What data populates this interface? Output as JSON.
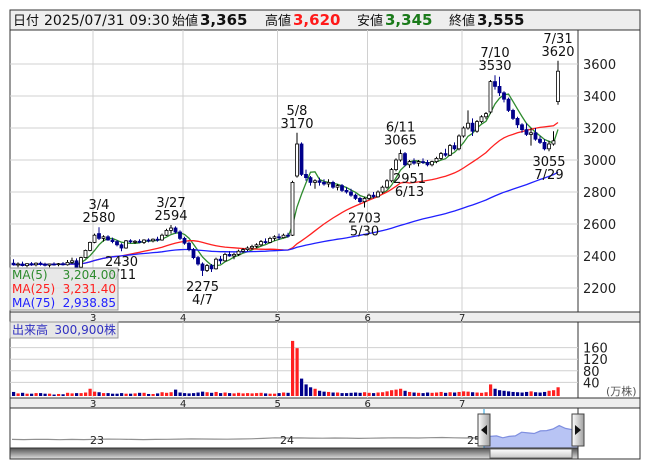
{
  "header": {
    "date_label": "日付",
    "datetime": "2025/07/31 09:30",
    "open_label": "始値",
    "open": "3,365",
    "high_label": "高値",
    "high": "3,620",
    "low_label": "安値",
    "low": "3,345",
    "close_label": "終値",
    "close": "3,555"
  },
  "legend": {
    "ma5_label": "MA(5)",
    "ma5_value": "3,204.00",
    "ma25_label": "MA(25)",
    "ma25_value": "3,231.40",
    "ma75_label": "MA(75)",
    "ma75_value": "2,938.85"
  },
  "volume_header": {
    "label": "出来高",
    "value": "300,900株"
  },
  "volume_unit": "(万株)",
  "colors": {
    "up_fill": "#ffffff",
    "down": "#00008b",
    "vol_up": "#ff2020",
    "vol_down": "#00008b",
    "vol_flat": "#808080",
    "ma5": "#2e8b2e",
    "ma25": "#ff2020",
    "ma75": "#2020ff",
    "nav_fill": "#b8c4f4",
    "nav_line": "#7f8fe0"
  },
  "chart_data": {
    "type": "candlestick",
    "ylim": [
      2150,
      3750
    ],
    "yticks": [
      2200,
      2400,
      2600,
      2800,
      3000,
      3200,
      3400,
      3600
    ],
    "volume_ticks": [
      40,
      80,
      120,
      160
    ],
    "volume_unit": "万株",
    "month_labels": [
      {
        "label": "3",
        "date": "3/3"
      },
      {
        "label": "4",
        "date": "4/1"
      },
      {
        "label": "5",
        "date": "5/1"
      },
      {
        "label": "6",
        "date": "6/2"
      },
      {
        "label": "7",
        "date": "7/1"
      }
    ],
    "ma_periods": [
      5,
      25,
      75
    ],
    "candles": [
      [
        "2/3",
        2355,
        2380,
        2340,
        2345,
        14
      ],
      [
        "2/4",
        2345,
        2360,
        2330,
        2350,
        9
      ],
      [
        "2/5",
        2350,
        2365,
        2335,
        2340,
        11
      ],
      [
        "2/6",
        2340,
        2355,
        2330,
        2352,
        8
      ],
      [
        "2/7",
        2352,
        2362,
        2338,
        2345,
        8
      ],
      [
        "2/10",
        2345,
        2360,
        2335,
        2355,
        10
      ],
      [
        "2/12",
        2355,
        2365,
        2340,
        2348,
        10
      ],
      [
        "2/13",
        2348,
        2358,
        2335,
        2342,
        8
      ],
      [
        "2/14",
        2342,
        2352,
        2330,
        2350,
        8
      ],
      [
        "2/17",
        2350,
        2360,
        2340,
        2346,
        5
      ],
      [
        "2/18",
        2346,
        2356,
        2336,
        2352,
        7
      ],
      [
        "2/19",
        2352,
        2362,
        2340,
        2345,
        6
      ],
      [
        "2/20",
        2345,
        2375,
        2340,
        2360,
        11
      ],
      [
        "2/21",
        2360,
        2390,
        2350,
        2370,
        9
      ],
      [
        "2/25",
        2370,
        2385,
        2320,
        2330,
        10
      ],
      [
        "2/26",
        2330,
        2395,
        2325,
        2390,
        10
      ],
      [
        "2/27",
        2390,
        2440,
        2385,
        2435,
        12
      ],
      [
        "2/28",
        2435,
        2490,
        2430,
        2485,
        25
      ],
      [
        "3/3",
        2485,
        2540,
        2480,
        2530,
        15
      ],
      [
        "3/4",
        2540,
        2580,
        2500,
        2510,
        13
      ],
      [
        "3/5",
        2510,
        2530,
        2490,
        2520,
        10
      ],
      [
        "3/6",
        2520,
        2530,
        2495,
        2500,
        10
      ],
      [
        "3/7",
        2500,
        2515,
        2480,
        2490,
        8
      ],
      [
        "3/10",
        2490,
        2500,
        2460,
        2470,
        8
      ],
      [
        "3/11",
        2470,
        2480,
        2430,
        2450,
        10
      ],
      [
        "3/12",
        2450,
        2500,
        2445,
        2495,
        8
      ],
      [
        "3/13",
        2495,
        2505,
        2480,
        2490,
        8
      ],
      [
        "3/14",
        2490,
        2500,
        2475,
        2492,
        9
      ],
      [
        "3/17",
        2492,
        2505,
        2480,
        2485,
        11
      ],
      [
        "3/18",
        2485,
        2505,
        2475,
        2500,
        11
      ],
      [
        "3/19",
        2500,
        2510,
        2485,
        2495,
        7
      ],
      [
        "3/21",
        2495,
        2510,
        2485,
        2505,
        7
      ],
      [
        "3/24",
        2505,
        2520,
        2490,
        2500,
        9
      ],
      [
        "3/25",
        2500,
        2540,
        2495,
        2530,
        13
      ],
      [
        "3/26",
        2530,
        2570,
        2525,
        2560,
        11
      ],
      [
        "3/27",
        2560,
        2594,
        2540,
        2575,
        13
      ],
      [
        "3/28",
        2575,
        2585,
        2540,
        2550,
        22
      ],
      [
        "3/31",
        2550,
        2560,
        2500,
        2510,
        12
      ],
      [
        "4/1",
        2510,
        2520,
        2470,
        2480,
        10
      ],
      [
        "4/2",
        2480,
        2490,
        2430,
        2440,
        9
      ],
      [
        "4/3",
        2440,
        2450,
        2380,
        2390,
        10
      ],
      [
        "4/4",
        2390,
        2400,
        2340,
        2350,
        12
      ],
      [
        "4/7",
        2350,
        2360,
        2275,
        2310,
        15
      ],
      [
        "4/8",
        2310,
        2350,
        2300,
        2340,
        13
      ],
      [
        "4/9",
        2340,
        2350,
        2300,
        2320,
        11
      ],
      [
        "4/10",
        2320,
        2390,
        2315,
        2380,
        14
      ],
      [
        "4/11",
        2380,
        2400,
        2350,
        2370,
        10
      ],
      [
        "4/14",
        2370,
        2420,
        2365,
        2410,
        12
      ],
      [
        "4/15",
        2410,
        2430,
        2395,
        2400,
        10
      ],
      [
        "4/16",
        2400,
        2420,
        2380,
        2410,
        9
      ],
      [
        "4/17",
        2410,
        2440,
        2400,
        2430,
        11
      ],
      [
        "4/18",
        2430,
        2450,
        2420,
        2440,
        9
      ],
      [
        "4/21",
        2440,
        2460,
        2430,
        2450,
        10
      ],
      [
        "4/22",
        2450,
        2470,
        2440,
        2460,
        9
      ],
      [
        "4/23",
        2460,
        2480,
        2450,
        2470,
        10
      ],
      [
        "4/24",
        2470,
        2500,
        2460,
        2490,
        11
      ],
      [
        "4/25",
        2490,
        2510,
        2475,
        2485,
        9
      ],
      [
        "4/28",
        2485,
        2520,
        2480,
        2510,
        8
      ],
      [
        "4/30",
        2510,
        2530,
        2495,
        2520,
        8
      ],
      [
        "5/1",
        2520,
        2540,
        2500,
        2515,
        10
      ],
      [
        "5/2",
        2515,
        2540,
        2510,
        2530,
        12
      ],
      [
        "5/7",
        2530,
        2545,
        2515,
        2525,
        11
      ],
      [
        "5/8",
        2530,
        2870,
        2525,
        2860,
        190
      ],
      [
        "5/9",
        2900,
        3170,
        2890,
        3100,
        165
      ],
      [
        "5/12",
        3100,
        3110,
        2900,
        2910,
        60
      ],
      [
        "5/13",
        2910,
        2940,
        2870,
        2890,
        40
      ],
      [
        "5/14",
        2890,
        2900,
        2840,
        2860,
        30
      ],
      [
        "5/15",
        2860,
        2880,
        2820,
        2870,
        25
      ],
      [
        "5/16",
        2870,
        2890,
        2840,
        2860,
        18
      ],
      [
        "5/19",
        2860,
        2880,
        2840,
        2850,
        15
      ],
      [
        "5/20",
        2850,
        2880,
        2830,
        2860,
        14
      ],
      [
        "5/21",
        2860,
        2870,
        2820,
        2830,
        12
      ],
      [
        "5/22",
        2830,
        2850,
        2810,
        2840,
        12
      ],
      [
        "5/23",
        2840,
        2850,
        2800,
        2810,
        10
      ],
      [
        "5/26",
        2810,
        2830,
        2790,
        2800,
        10
      ],
      [
        "5/27",
        2800,
        2820,
        2770,
        2780,
        11
      ],
      [
        "5/28",
        2780,
        2790,
        2750,
        2760,
        12
      ],
      [
        "5/29",
        2760,
        2770,
        2730,
        2740,
        11
      ],
      [
        "5/30",
        2740,
        2770,
        2703,
        2760,
        13
      ],
      [
        "6/2",
        2760,
        2790,
        2750,
        2780,
        11
      ],
      [
        "6/3",
        2780,
        2800,
        2760,
        2770,
        10
      ],
      [
        "6/4",
        2770,
        2810,
        2765,
        2800,
        12
      ],
      [
        "6/5",
        2800,
        2840,
        2790,
        2830,
        13
      ],
      [
        "6/6",
        2830,
        2880,
        2820,
        2870,
        16
      ],
      [
        "6/9",
        2870,
        2950,
        2860,
        2940,
        20
      ],
      [
        "6/10",
        2940,
        3010,
        2930,
        3000,
        22
      ],
      [
        "6/11",
        3000,
        3065,
        2990,
        3040,
        25
      ],
      [
        "6/12",
        3040,
        3050,
        2960,
        2970,
        18
      ],
      [
        "6/13",
        2970,
        3000,
        2951,
        2990,
        14
      ],
      [
        "6/16",
        2990,
        3010,
        2970,
        2980,
        12
      ],
      [
        "6/17",
        2980,
        3000,
        2960,
        2990,
        11
      ],
      [
        "6/18",
        2990,
        3010,
        2975,
        2985,
        10
      ],
      [
        "6/19",
        2985,
        3000,
        2960,
        2970,
        12
      ],
      [
        "6/20",
        2970,
        2995,
        2960,
        2990,
        11
      ],
      [
        "6/23",
        2990,
        3020,
        2980,
        3010,
        12
      ],
      [
        "6/24",
        3010,
        3050,
        3000,
        3040,
        14
      ],
      [
        "6/25",
        3040,
        3070,
        3020,
        3030,
        11
      ],
      [
        "6/26",
        3030,
        3100,
        3025,
        3090,
        13
      ],
      [
        "6/27",
        3090,
        3110,
        3060,
        3070,
        12
      ],
      [
        "6/30",
        3070,
        3160,
        3060,
        3150,
        14
      ],
      [
        "7/1",
        3150,
        3210,
        3140,
        3200,
        16
      ],
      [
        "7/2",
        3200,
        3310,
        3190,
        3230,
        15
      ],
      [
        "7/3",
        3230,
        3260,
        3150,
        3180,
        13
      ],
      [
        "7/4",
        3180,
        3250,
        3170,
        3240,
        12
      ],
      [
        "7/7",
        3240,
        3280,
        3230,
        3270,
        11
      ],
      [
        "7/8",
        3270,
        3300,
        3255,
        3290,
        13
      ],
      [
        "7/9",
        3300,
        3500,
        3290,
        3490,
        40
      ],
      [
        "7/10",
        3490,
        3530,
        3440,
        3460,
        25
      ],
      [
        "7/11",
        3460,
        3520,
        3400,
        3420,
        20
      ],
      [
        "7/14",
        3420,
        3430,
        3360,
        3380,
        18
      ],
      [
        "7/15",
        3380,
        3390,
        3300,
        3310,
        16
      ],
      [
        "7/16",
        3310,
        3320,
        3250,
        3260,
        14
      ],
      [
        "7/17",
        3260,
        3270,
        3200,
        3220,
        13
      ],
      [
        "7/18",
        3220,
        3230,
        3170,
        3190,
        12
      ],
      [
        "7/22",
        3190,
        3230,
        3150,
        3160,
        14
      ],
      [
        "7/23",
        3160,
        3200,
        3090,
        3170,
        16
      ],
      [
        "7/24",
        3170,
        3200,
        3120,
        3130,
        13
      ],
      [
        "7/25",
        3130,
        3150,
        3100,
        3110,
        12
      ],
      [
        "7/28",
        3110,
        3130,
        3060,
        3070,
        14
      ],
      [
        "7/29",
        3070,
        3120,
        3055,
        3100,
        18
      ],
      [
        "7/30",
        3100,
        3180,
        3090,
        3120,
        20
      ],
      [
        "7/31",
        3365,
        3620,
        3345,
        3555,
        30.09
      ]
    ],
    "annotations": [
      {
        "date": "3/4",
        "value": "2580",
        "pos": "above"
      },
      {
        "date": "3/11",
        "value": "2430",
        "pos": "below"
      },
      {
        "date": "3/27",
        "value": "2594",
        "pos": "above"
      },
      {
        "date": "4/7",
        "value": "2275",
        "pos": "below"
      },
      {
        "date": "5/9",
        "value": "3170",
        "pos": "above",
        "text_date": "5/8"
      },
      {
        "date": "5/30",
        "value": "2703",
        "pos": "below"
      },
      {
        "date": "6/11",
        "value": "3065",
        "pos": "above"
      },
      {
        "date": "6/13",
        "value": "2951",
        "pos": "below"
      },
      {
        "date": "7/10",
        "value": "3530",
        "pos": "above"
      },
      {
        "date": "7/29",
        "value": "3055",
        "pos": "below"
      },
      {
        "date": "7/31",
        "value": "3620",
        "pos": "above"
      }
    ]
  },
  "navigator": {
    "year_labels": [
      "23",
      "24",
      "25"
    ],
    "history": [
      2200,
      2190,
      2210,
      2200,
      2180,
      2200,
      2190,
      2210,
      2230,
      2220,
      2200,
      2190,
      2200,
      2210,
      2230,
      2250,
      2240,
      2230,
      2220,
      2240,
      2260,
      2300,
      2350,
      2330,
      2340,
      2320,
      2310,
      2330,
      2320,
      2300,
      2310,
      2330,
      2350,
      2340,
      2330,
      2360,
      2380,
      2350,
      2330,
      2340
    ],
    "selected": [
      2340,
      2480,
      2520,
      2350,
      2480,
      2520,
      2860,
      2800,
      2740,
      2980,
      3000,
      3150,
      3460,
      3200,
      3100,
      3555
    ]
  }
}
